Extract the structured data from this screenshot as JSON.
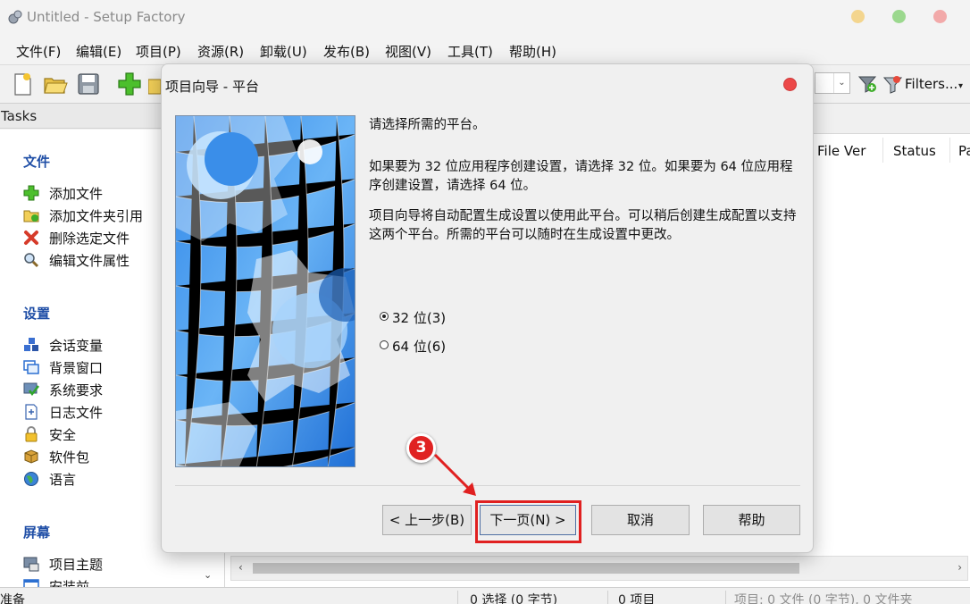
{
  "window": {
    "title": "Untitled - Setup Factory"
  },
  "menu": [
    "文件(F)",
    "编辑(E)",
    "项目(P)",
    "资源(R)",
    "卸载(U)",
    "发布(B)",
    "视图(V)",
    "工具(T)",
    "帮助(H)"
  ],
  "toolbar": {
    "filters_label": "Filters..."
  },
  "tasks": {
    "header": "Tasks",
    "sections": [
      {
        "title": "文件",
        "items": [
          "添加文件",
          "添加文件夹引用",
          "删除选定文件",
          "编辑文件属性"
        ]
      },
      {
        "title": "设置",
        "items": [
          "会话变量",
          "背景窗口",
          "系统要求",
          "日志文件",
          "安全",
          "软件包",
          "语言"
        ]
      },
      {
        "title": "屏幕",
        "items": [
          "项目主题",
          "安装前"
        ]
      }
    ]
  },
  "list": {
    "columns": [
      "File Ver",
      "Status",
      "Pa"
    ]
  },
  "status": {
    "ready": "准备",
    "selection": "0 选择 (0 字节)",
    "items": "0 项目",
    "summary": "项目: 0 文件 (0 字节), 0 文件夹"
  },
  "dialog": {
    "title": "项目向导 - 平台",
    "heading": "请选择所需的平台。",
    "paragraph1": "如果要为 32 位应用程序创建设置，请选择 32 位。如果要为 64 位应用程序创建设置，请选择 64 位。",
    "paragraph2": "项目向导将自动配置生成设置以使用此平台。可以稍后创建生成配置以支持这两个平台。所需的平台可以随时在生成设置中更改。",
    "options": [
      {
        "label": "32 位(3)",
        "selected": true
      },
      {
        "label": "64 位(6)",
        "selected": false
      }
    ],
    "buttons": {
      "back": "< 上一步(B)",
      "next": "下一页(N) >",
      "cancel": "取消",
      "help": "帮助"
    }
  },
  "annotation": {
    "step": "3"
  },
  "colors": {
    "accent_red": "#e02020",
    "section_title": "#1f4ea6"
  }
}
